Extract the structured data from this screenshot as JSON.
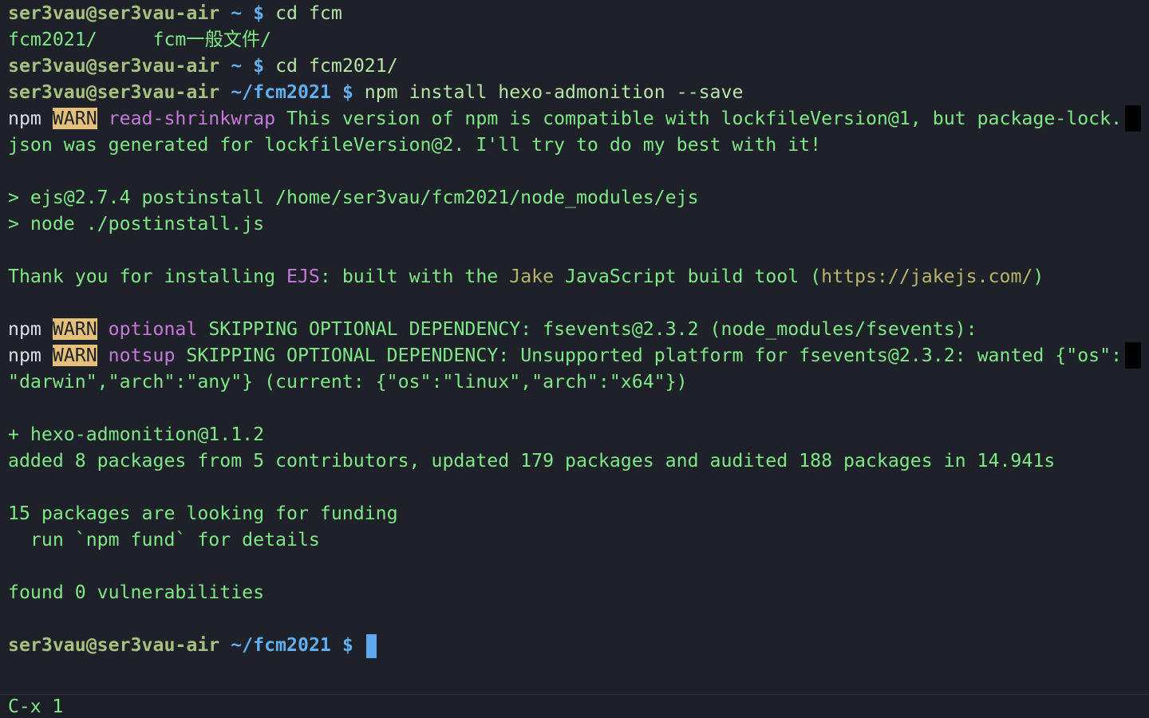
{
  "prompt1": {
    "user": "ser3vau@ser3vau-air",
    "path": "~",
    "dollar": "$",
    "cmd": "cd fcm"
  },
  "completions": {
    "items": [
      "fcm2021/",
      "fcm一般文件/"
    ]
  },
  "prompt2": {
    "user": "ser3vau@ser3vau-air",
    "path": "~",
    "dollar": "$",
    "cmd": "cd fcm2021/"
  },
  "prompt3": {
    "user": "ser3vau@ser3vau-air",
    "path": "~/fcm2021",
    "dollar": "$",
    "cmd": "npm install hexo-admonition --save"
  },
  "warn1": {
    "npm": "npm",
    "level": "WARN",
    "code": "read-shrinkwrap",
    "message": "This version of npm is compatible with lockfileVersion@1, but package-lock.",
    "continuation": "json was generated for lockfileVersion@2. I'll try to do my best with it!"
  },
  "postinstall": {
    "line1": "> ejs@2.7.4 postinstall /home/ser3vau/fcm2021/node_modules/ejs",
    "line2": "> node ./postinstall.js"
  },
  "thanks": {
    "part1": "Thank you for installing ",
    "ejs": "EJS",
    "part2": ": built with the ",
    "jake": "Jake",
    "part3": " JavaScript build tool (",
    "url": "https://jakejs.com/",
    "part4": ")"
  },
  "warn2": {
    "npm": "npm",
    "level": "WARN",
    "code": "optional",
    "message": "SKIPPING OPTIONAL DEPENDENCY: fsevents@2.3.2 (node_modules/fsevents):"
  },
  "warn3": {
    "npm": "npm",
    "level": "WARN",
    "code": "notsup",
    "message": "SKIPPING OPTIONAL DEPENDENCY: Unsupported platform for fsevents@2.3.2: wanted {\"os\":",
    "continuation": "\"darwin\",\"arch\":\"any\"} (current: {\"os\":\"linux\",\"arch\":\"x64\"})"
  },
  "result": {
    "added_pkg": "+ hexo-admonition@1.1.2",
    "summary": "added 8 packages from 5 contributors, updated 179 packages and audited 188 packages in 14.941s"
  },
  "funding": {
    "line1": "15 packages are looking for funding",
    "line2": "  run `npm fund` for details"
  },
  "audit": {
    "line": "found 0 vulnerabilities"
  },
  "prompt4": {
    "user": "ser3vau@ser3vau-air",
    "path": "~/fcm2021",
    "dollar": "$"
  },
  "statusbar": {
    "text": "C-x 1"
  },
  "colors": {
    "background": "#1e2127",
    "text_green": "#7ee787",
    "prompt_user": "#a7c080",
    "prompt_path": "#61afef",
    "warn_bg": "#e5c07b",
    "magenta": "#c678dd",
    "olive": "#b8b36a",
    "cursor": "#5fa8f0"
  }
}
